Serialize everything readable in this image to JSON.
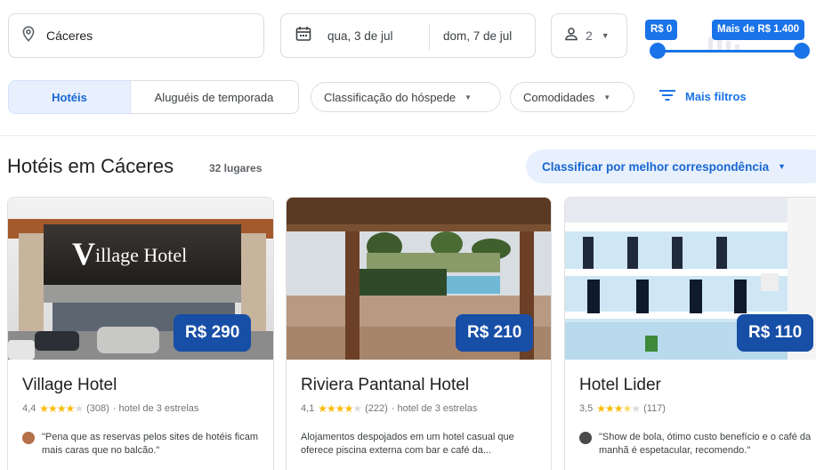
{
  "search": {
    "location": "Cáceres",
    "checkin": "qua, 3 de jul",
    "checkout": "dom, 7 de jul",
    "guests": "2"
  },
  "price_filter": {
    "min_label": "R$ 0",
    "max_label": "Mais de R$ 1.400"
  },
  "tabs": {
    "hotels": "Hotéis",
    "rentals": "Aluguéis de temporada"
  },
  "filters": {
    "rating": "Classificação do hóspede",
    "amenities": "Comodidades",
    "more": "Mais filtros"
  },
  "results": {
    "title": "Hotéis em Cáceres",
    "count": "32 lugares",
    "sort": "Classificar por melhor correspondência"
  },
  "hotels": [
    {
      "name": "Village Hotel",
      "price": "R$ 290",
      "rating": "4,4",
      "rating_value": 4.4,
      "reviews": "(308)",
      "category": "· hotel de 3 estrelas",
      "snippet": "\"Pena que as reservas pelos sites de hotéis ficam mais caras que no balcão.\"",
      "sign_text": "illage Hotel",
      "sign_initial": "V"
    },
    {
      "name": "Riviera Pantanal Hotel",
      "price": "R$ 210",
      "rating": "4,1",
      "rating_value": 4.1,
      "reviews": "(222)",
      "category": "· hotel de 3 estrelas",
      "snippet": "Alojamentos despojados em um hotel casual que oferece piscina externa com bar e café da..."
    },
    {
      "name": "Hotel Lider",
      "price": "R$ 110",
      "rating": "3,5",
      "rating_value": 3.5,
      "reviews": "(117)",
      "category": "",
      "snippet": "\"Show de bola, ótimo custo benefício e o café da manhã é espetacular, recomendo.\""
    }
  ],
  "colors": {
    "accent": "#1a73e8",
    "price_tag": "#174ea6",
    "star": "#fbbc04",
    "chip_selected": "#e8f0fe"
  }
}
